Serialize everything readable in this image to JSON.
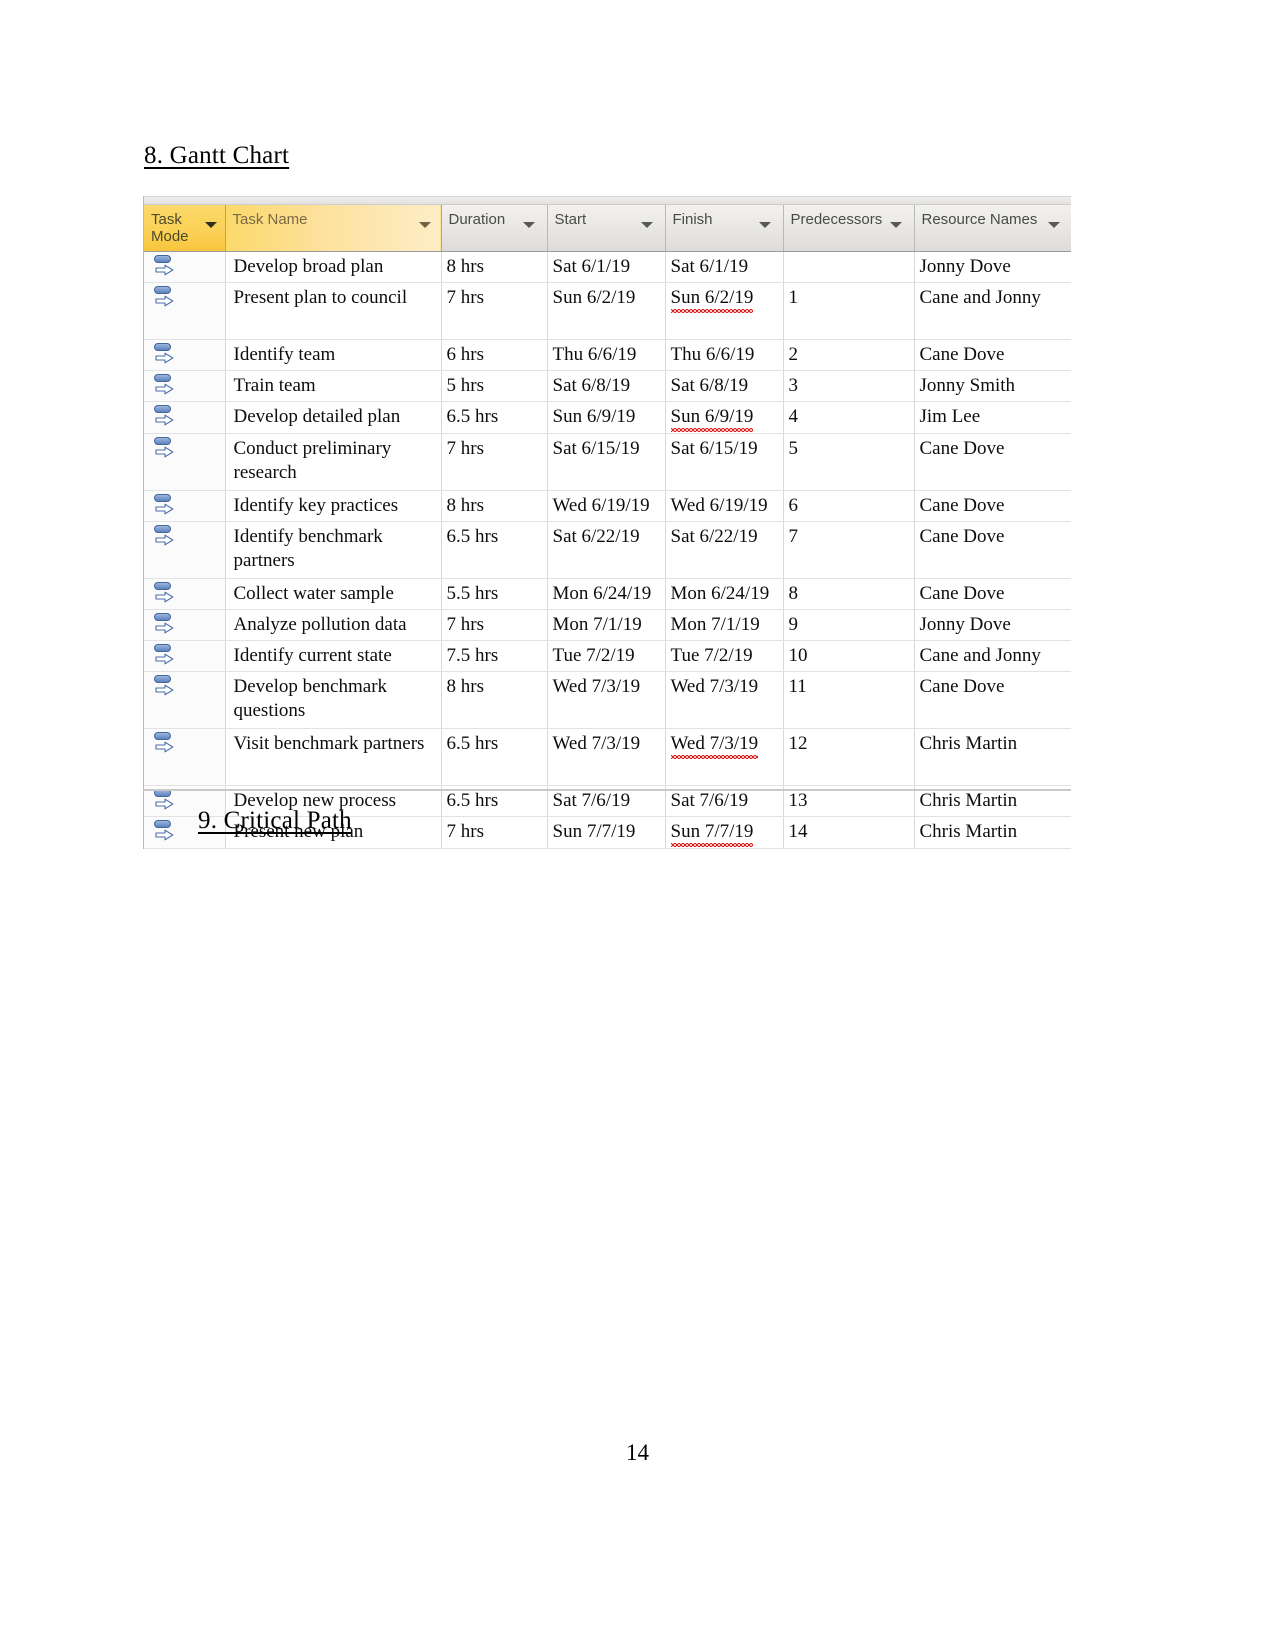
{
  "document": {
    "heading_gantt": "8. Gantt Chart",
    "heading_critical": "9. Critical Path",
    "page_number": "14"
  },
  "table": {
    "columns": [
      {
        "key": "task_mode",
        "label": "Task\nMode",
        "icon": "sort-dropdown-icon",
        "style": "yellow-solid"
      },
      {
        "key": "task_name",
        "label": "Task Name",
        "icon": "sort-dropdown-icon",
        "style": "yellow-grad"
      },
      {
        "key": "duration",
        "label": "Duration",
        "icon": "sort-dropdown-icon",
        "style": "grey"
      },
      {
        "key": "start",
        "label": "Start",
        "icon": "sort-dropdown-icon",
        "style": "grey"
      },
      {
        "key": "finish",
        "label": "Finish",
        "icon": "sort-dropdown-icon",
        "style": "grey"
      },
      {
        "key": "predecessors",
        "label": "Predecessors",
        "icon": "sort-dropdown-icon",
        "style": "grey"
      },
      {
        "key": "resource_names",
        "label": "Resource Names",
        "icon": "sort-dropdown-icon",
        "style": "grey"
      }
    ],
    "header_labels": {
      "task_mode_line1": "Task",
      "task_mode_line2": "Mode",
      "task_name": "Task Name",
      "duration": "Duration",
      "start": "Start",
      "finish": "Finish",
      "predecessors": "Predecessors",
      "resource_names": "Resource Names"
    },
    "rows": [
      {
        "task_mode_icon": "auto-scheduled-icon",
        "task_name": "Develop broad plan",
        "duration": "8 hrs",
        "start": "Sat 6/1/19",
        "finish": "Sat 6/1/19",
        "finish_misspelled": false,
        "predecessors": "",
        "resource_names": "Jonny Dove",
        "tall": false
      },
      {
        "task_mode_icon": "auto-scheduled-icon",
        "task_name": "Present plan to council",
        "duration": "7 hrs",
        "start": "Sun 6/2/19",
        "finish": "Sun 6/2/19",
        "finish_misspelled": true,
        "predecessors": "1",
        "resource_names": "Cane and Jonny",
        "tall": true
      },
      {
        "task_mode_icon": "auto-scheduled-icon",
        "task_name": "Identify team",
        "duration": "6 hrs",
        "start": "Thu 6/6/19",
        "finish": "Thu 6/6/19",
        "finish_misspelled": false,
        "predecessors": "2",
        "resource_names": "Cane Dove",
        "tall": false
      },
      {
        "task_mode_icon": "auto-scheduled-icon",
        "task_name": "Train team",
        "duration": "5 hrs",
        "start": "Sat 6/8/19",
        "finish": "Sat 6/8/19",
        "finish_misspelled": false,
        "predecessors": "3",
        "resource_names": "Jonny Smith",
        "tall": false
      },
      {
        "task_mode_icon": "auto-scheduled-icon",
        "task_name": "Develop detailed plan",
        "duration": "6.5 hrs",
        "start": "Sun 6/9/19",
        "finish": "Sun 6/9/19",
        "finish_misspelled": true,
        "predecessors": "4",
        "resource_names": "Jim Lee",
        "tall": false
      },
      {
        "task_mode_icon": "auto-scheduled-icon",
        "task_name": "Conduct preliminary research",
        "duration": "7 hrs",
        "start": "Sat 6/15/19",
        "finish": "Sat 6/15/19",
        "finish_misspelled": false,
        "predecessors": "5",
        "resource_names": "Cane Dove",
        "tall": true
      },
      {
        "task_mode_icon": "auto-scheduled-icon",
        "task_name": "Identify key practices",
        "duration": "8 hrs",
        "start": "Wed 6/19/19",
        "finish": "Wed 6/19/19",
        "finish_misspelled": false,
        "predecessors": "6",
        "resource_names": "Cane Dove",
        "tall": false
      },
      {
        "task_mode_icon": "auto-scheduled-icon",
        "task_name": "Identify benchmark partners",
        "duration": "6.5 hrs",
        "start": "Sat 6/22/19",
        "finish": "Sat 6/22/19",
        "finish_misspelled": false,
        "predecessors": "7",
        "resource_names": "Cane Dove",
        "tall": true
      },
      {
        "task_mode_icon": "auto-scheduled-icon",
        "task_name": "Collect water sample",
        "duration": "5.5 hrs",
        "start": "Mon 6/24/19",
        "finish": "Mon 6/24/19",
        "finish_misspelled": false,
        "predecessors": "8",
        "resource_names": "Cane Dove",
        "tall": false
      },
      {
        "task_mode_icon": "auto-scheduled-icon",
        "task_name": "Analyze pollution data",
        "duration": "7 hrs",
        "start": "Mon 7/1/19",
        "finish": "Mon 7/1/19",
        "finish_misspelled": false,
        "predecessors": "9",
        "resource_names": "Jonny Dove",
        "tall": false
      },
      {
        "task_mode_icon": "auto-scheduled-icon",
        "task_name": "Identify current state",
        "duration": "7.5 hrs",
        "start": "Tue 7/2/19",
        "finish": "Tue 7/2/19",
        "finish_misspelled": false,
        "predecessors": "10",
        "resource_names": "Cane and Jonny",
        "tall": false
      },
      {
        "task_mode_icon": "auto-scheduled-icon",
        "task_name": "Develop benchmark questions",
        "duration": "8 hrs",
        "start": "Wed 7/3/19",
        "finish": "Wed 7/3/19",
        "finish_misspelled": false,
        "predecessors": "11",
        "resource_names": "Cane Dove",
        "tall": true
      },
      {
        "task_mode_icon": "auto-scheduled-icon",
        "task_name": "Visit benchmark partners",
        "duration": "6.5 hrs",
        "start": "Wed 7/3/19",
        "finish": "Wed 7/3/19",
        "finish_misspelled": true,
        "predecessors": "12",
        "resource_names": "Chris Martin",
        "tall": true
      },
      {
        "task_mode_icon": "auto-scheduled-icon",
        "task_name": "Develop new process",
        "duration": "6.5 hrs",
        "start": "Sat 7/6/19",
        "finish": "Sat 7/6/19",
        "finish_misspelled": false,
        "predecessors": "13",
        "resource_names": "Chris Martin",
        "tall": false
      },
      {
        "task_mode_icon": "auto-scheduled-icon",
        "task_name": "Present new plan",
        "duration": "7 hrs",
        "start": "Sun 7/7/19",
        "finish": "Sun 7/7/19",
        "finish_misspelled": true,
        "predecessors": "14",
        "resource_names": "Chris Martin",
        "tall": false
      }
    ]
  },
  "colors": {
    "header_yellow": "#fbd055",
    "header_yellow_light": "#fdeec7",
    "header_grey": "#e8e6e3",
    "grid_line": "#d9d9d9",
    "spellcheck_red": "#e02020",
    "icon_blue": "#5b82bd",
    "text": "#0d0d0d"
  }
}
